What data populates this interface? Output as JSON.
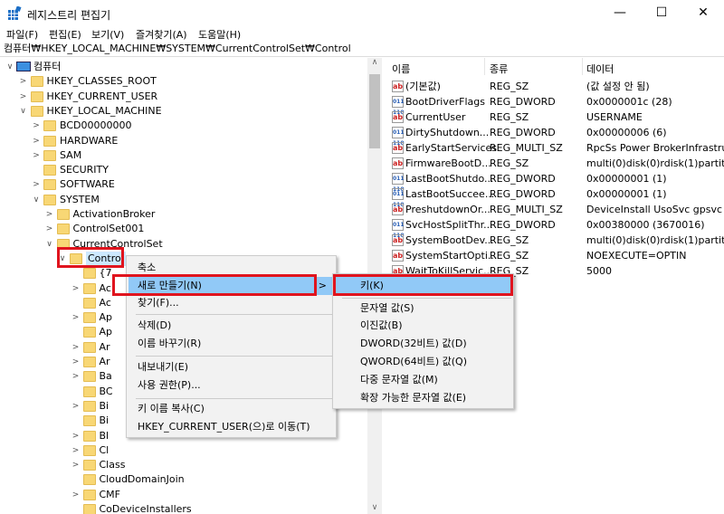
{
  "window": {
    "title": "레지스트리 편집기",
    "minimize": "—",
    "maximize": "☐",
    "close": "✕"
  },
  "menubar": [
    "파일(F)",
    "편집(E)",
    "보기(V)",
    "즐겨찾기(A)",
    "도움말(H)"
  ],
  "address": "컴퓨터₩HKEY_LOCAL_MACHINE₩SYSTEM₩CurrentControlSet₩Control",
  "tree": [
    {
      "label": "컴퓨터",
      "level": 0,
      "toggle": "∨",
      "computer": true
    },
    {
      "label": "HKEY_CLASSES_ROOT",
      "level": 1,
      "toggle": ">"
    },
    {
      "label": "HKEY_CURRENT_USER",
      "level": 1,
      "toggle": ">"
    },
    {
      "label": "HKEY_LOCAL_MACHINE",
      "level": 1,
      "toggle": "∨"
    },
    {
      "label": "BCD00000000",
      "level": 2,
      "toggle": ">"
    },
    {
      "label": "HARDWARE",
      "level": 2,
      "toggle": ">"
    },
    {
      "label": "SAM",
      "level": 2,
      "toggle": ">"
    },
    {
      "label": "SECURITY",
      "level": 2,
      "toggle": ""
    },
    {
      "label": "SOFTWARE",
      "level": 2,
      "toggle": ">"
    },
    {
      "label": "SYSTEM",
      "level": 2,
      "toggle": "∨"
    },
    {
      "label": "ActivationBroker",
      "level": 3,
      "toggle": ">"
    },
    {
      "label": "ControlSet001",
      "level": 3,
      "toggle": ">"
    },
    {
      "label": "CurrentControlSet",
      "level": 3,
      "toggle": "∨"
    },
    {
      "label": "Control",
      "level": 4,
      "toggle": "∨",
      "selected": true
    },
    {
      "label": "{7",
      "level": 5,
      "toggle": ""
    },
    {
      "label": "Ac",
      "level": 5,
      "toggle": ">"
    },
    {
      "label": "Ac",
      "level": 5,
      "toggle": ""
    },
    {
      "label": "Ap",
      "level": 5,
      "toggle": ">"
    },
    {
      "label": "Ap",
      "level": 5,
      "toggle": ""
    },
    {
      "label": "Ar",
      "level": 5,
      "toggle": ">"
    },
    {
      "label": "Ar",
      "level": 5,
      "toggle": ">"
    },
    {
      "label": "Ba",
      "level": 5,
      "toggle": ">"
    },
    {
      "label": "BC",
      "level": 5,
      "toggle": ""
    },
    {
      "label": "Bi",
      "level": 5,
      "toggle": ">"
    },
    {
      "label": "Bi",
      "level": 5,
      "toggle": ""
    },
    {
      "label": "Bl",
      "level": 5,
      "toggle": ">"
    },
    {
      "label": "Cl",
      "level": 5,
      "toggle": ">"
    },
    {
      "label": "Class",
      "level": 5,
      "toggle": ">"
    },
    {
      "label": "CloudDomainJoin",
      "level": 5,
      "toggle": ""
    },
    {
      "label": "CMF",
      "level": 5,
      "toggle": ">"
    },
    {
      "label": "CoDeviceInstallers",
      "level": 5,
      "toggle": ""
    }
  ],
  "values": {
    "headers": [
      "이름",
      "종류",
      "데이터"
    ],
    "rows": [
      {
        "icon": "ab",
        "name": "(기본값)",
        "type": "REG_SZ",
        "data": "(값 설정 안 됨)"
      },
      {
        "icon": "bin",
        "name": "BootDriverFlags",
        "type": "REG_DWORD",
        "data": "0x0000001c (28)"
      },
      {
        "icon": "ab",
        "name": "CurrentUser",
        "type": "REG_SZ",
        "data": "USERNAME"
      },
      {
        "icon": "bin",
        "name": "DirtyShutdown...",
        "type": "REG_DWORD",
        "data": "0x00000006 (6)"
      },
      {
        "icon": "ab",
        "name": "EarlyStartServices",
        "type": "REG_MULTI_SZ",
        "data": "RpcSs Power BrokerInfrastructu"
      },
      {
        "icon": "ab",
        "name": "FirmwareBootD...",
        "type": "REG_SZ",
        "data": "multi(0)disk(0)rdisk(1)partition"
      },
      {
        "icon": "bin",
        "name": "LastBootShutdo...",
        "type": "REG_DWORD",
        "data": "0x00000001 (1)"
      },
      {
        "icon": "bin",
        "name": "LastBootSuccee...",
        "type": "REG_DWORD",
        "data": "0x00000001 (1)"
      },
      {
        "icon": "ab",
        "name": "PreshutdownOr...",
        "type": "REG_MULTI_SZ",
        "data": "DeviceInstall UsoSvc gpsvc trus"
      },
      {
        "icon": "bin",
        "name": "SvcHostSplitThr...",
        "type": "REG_DWORD",
        "data": "0x00380000 (3670016)"
      },
      {
        "icon": "ab",
        "name": "SystemBootDev...",
        "type": "REG_SZ",
        "data": "multi(0)disk(0)rdisk(1)partition"
      },
      {
        "icon": "ab",
        "name": "SystemStartOpti...",
        "type": "REG_SZ",
        "data": " NOEXECUTE=OPTIN"
      },
      {
        "icon": "ab",
        "name": "WaitToKillServic...",
        "type": "REG_SZ",
        "data": "5000"
      }
    ]
  },
  "context_menu": {
    "collapse": "축소",
    "new": "새로 만들기(N)",
    "find": "찾기(F)...",
    "delete": "삭제(D)",
    "rename": "이름 바꾸기(R)",
    "export": "내보내기(E)",
    "permissions": "사용 권한(P)...",
    "copy_key": "키 이름 복사(C)",
    "goto_hkcu": "HKEY_CURRENT_USER(으)로 이동(T)",
    "arrow": ">"
  },
  "submenu": {
    "key": "키(K)",
    "string": "문자열 값(S)",
    "binary": "이진값(B)",
    "dword": "DWORD(32비트) 값(D)",
    "qword": "QWORD(64비트) 값(Q)",
    "multi": "다중 문자열 값(M)",
    "expand": "확장 가능한 문자열 값(E)"
  },
  "colors": {
    "highlight": "#91c9f7",
    "annotation": "#e0141e"
  }
}
